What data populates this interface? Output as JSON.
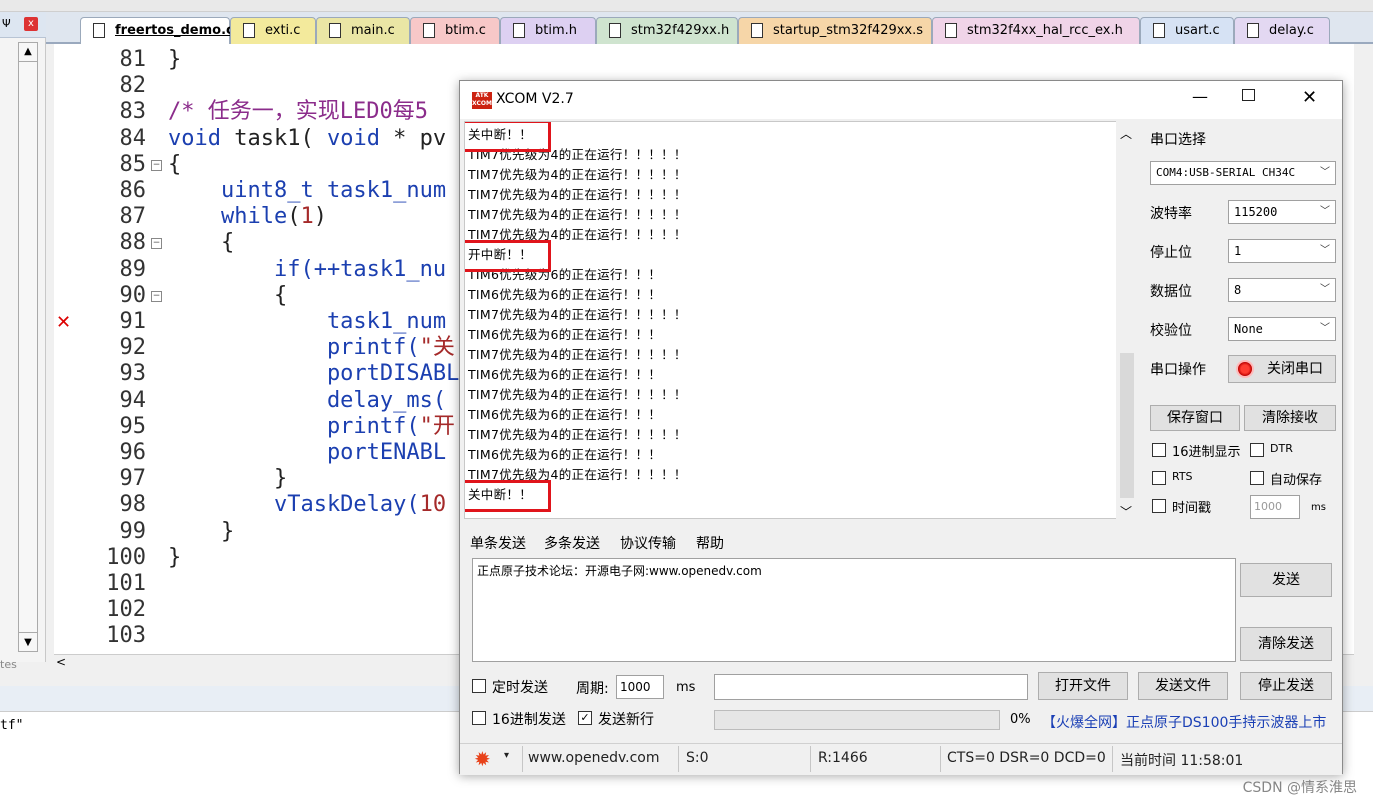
{
  "left_panel": {
    "pin": "Ψ",
    "close": "x",
    "bottom_text": "tes"
  },
  "tabs": [
    {
      "label": "freertos_demo.c",
      "color": "#ffffff"
    },
    {
      "label": "exti.c",
      "color": "#f3ea9c"
    },
    {
      "label": "main.c",
      "color": "#eae6a5"
    },
    {
      "label": "btim.c",
      "color": "#f7c8c8"
    },
    {
      "label": "btim.h",
      "color": "#ddd0f2"
    },
    {
      "label": "stm32f429xx.h",
      "color": "#cfe4cf"
    },
    {
      "label": "startup_stm32f429xx.s",
      "color": "#f6d6a8"
    },
    {
      "label": "stm32f4xx_hal_rcc_ex.h",
      "color": "#f0d4e8"
    },
    {
      "label": "usart.c",
      "color": "#d6e2f4"
    },
    {
      "label": "delay.c",
      "color": "#e3d8f2"
    }
  ],
  "editor": {
    "line_numbers": [
      "81",
      "82",
      "83",
      "84",
      "85",
      "86",
      "87",
      "88",
      "89",
      "90",
      "91",
      "92",
      "93",
      "94",
      "95",
      "96",
      "97",
      "98",
      "99",
      "100",
      "101",
      "102",
      "103"
    ],
    "lines": [
      [
        {
          "t": "}",
          "c": ""
        }
      ],
      [
        {
          "t": "",
          "c": ""
        }
      ],
      [
        {
          "t": "/* 任务一，实现LED0每5",
          "c": "cm"
        }
      ],
      [
        {
          "t": "void",
          "c": "kw"
        },
        {
          "t": " task1( ",
          "c": ""
        },
        {
          "t": "void",
          "c": "kw"
        },
        {
          "t": " * pv",
          "c": ""
        }
      ],
      [
        {
          "t": "{",
          "c": ""
        }
      ],
      [
        {
          "t": "    uint8_t task1_num",
          "c": "kw"
        }
      ],
      [
        {
          "t": "    ",
          "c": ""
        },
        {
          "t": "while",
          "c": "kw"
        },
        {
          "t": "(",
          "c": ""
        },
        {
          "t": "1",
          "c": "num"
        },
        {
          "t": ")",
          "c": ""
        }
      ],
      [
        {
          "t": "    {",
          "c": ""
        }
      ],
      [
        {
          "t": "        if(++task1_nu",
          "c": "kw"
        }
      ],
      [
        {
          "t": "        {",
          "c": ""
        }
      ],
      [
        {
          "t": "            task1_num",
          "c": "kw"
        }
      ],
      [
        {
          "t": "            printf(",
          "c": "kw"
        },
        {
          "t": "\"关",
          "c": "str"
        }
      ],
      [
        {
          "t": "            portDISABL",
          "c": "kw"
        }
      ],
      [
        {
          "t": "            delay_ms(",
          "c": "kw"
        }
      ],
      [
        {
          "t": "            printf(",
          "c": "kw"
        },
        {
          "t": "\"开",
          "c": "str"
        }
      ],
      [
        {
          "t": "            portENABL",
          "c": "kw"
        }
      ],
      [
        {
          "t": "        }",
          "c": ""
        }
      ],
      [
        {
          "t": "        vTaskDelay(",
          "c": "kw"
        },
        {
          "t": "10",
          "c": "num"
        }
      ],
      [
        {
          "t": "    }",
          "c": ""
        }
      ],
      [
        {
          "t": "}",
          "c": ""
        }
      ],
      [
        {
          "t": "",
          "c": ""
        }
      ],
      [
        {
          "t": "",
          "c": ""
        }
      ],
      [
        {
          "t": "",
          "c": ""
        }
      ]
    ],
    "error_mark": "✕",
    "scroll_left": "<"
  },
  "build_output": {
    "text": "tf\""
  },
  "watermark": "CSDN @情系淮思",
  "xcom": {
    "title": "XCOM V2.7",
    "logo": "ATK XCOM",
    "rx_lines": [
      "关中断！！",
      "TIM7优先级为4的正在运行！！！！！",
      "TIM7优先级为4的正在运行！！！！！",
      "TIM7优先级为4的正在运行！！！！！",
      "TIM7优先级为4的正在运行！！！！！",
      "TIM7优先级为4的正在运行！！！！！",
      "开中断！！",
      "TIM6优先级为6的正在运行！！！",
      "TIM6优先级为6的正在运行！！！",
      "TIM7优先级为4的正在运行！！！！！",
      "TIM6优先级为6的正在运行！！！",
      "TIM7优先级为4的正在运行！！！！！",
      "TIM6优先级为6的正在运行！！！",
      "TIM7优先级为4的正在运行！！！！！",
      "TIM6优先级为6的正在运行！！！",
      "TIM7优先级为4的正在运行！！！！！",
      "TIM6优先级为6的正在运行！！！",
      "TIM7优先级为4的正在运行！！！！！",
      "关中断！！"
    ],
    "settings": {
      "port_label": "串口选择",
      "port_value": "COM4:USB-SERIAL CH34C",
      "baud_label": "波特率",
      "baud_value": "115200",
      "stop_label": "停止位",
      "stop_value": "1",
      "data_label": "数据位",
      "data_value": "8",
      "parity_label": "校验位",
      "parity_value": "None",
      "op_label": "串口操作",
      "close_port": "关闭串口",
      "save_window": "保存窗口",
      "clear_rx": "清除接收",
      "hex_display": "16进制显示",
      "dtr": "DTR",
      "rts": "RTS",
      "auto_save": "自动保存",
      "timestamp": "时间戳",
      "timestamp_value": "1000",
      "ms": "ms"
    },
    "send_tabs": [
      "单条发送",
      "多条发送",
      "协议传输",
      "帮助"
    ],
    "tx_text": "正点原子技术论坛：开源电子网:www.openedv.com",
    "send_btn": "发送",
    "clear_send": "清除发送",
    "timed_send": "定时发送",
    "period_label": "周期:",
    "period_value": "1000",
    "period_unit": "ms",
    "open_file": "打开文件",
    "send_file": "发送文件",
    "stop_send": "停止发送",
    "hex_send": "16进制发送",
    "send_newline": "发送新行",
    "progress_pct": "0%",
    "progress_value": 0,
    "ad_link": "【火爆全网】正点原子DS100手持示波器上市",
    "status": {
      "url": "www.openedv.com",
      "s": "S:0",
      "r": "R:1466",
      "lines": "CTS=0 DSR=0 DCD=0",
      "time": "当前时间 11:58:01"
    }
  }
}
